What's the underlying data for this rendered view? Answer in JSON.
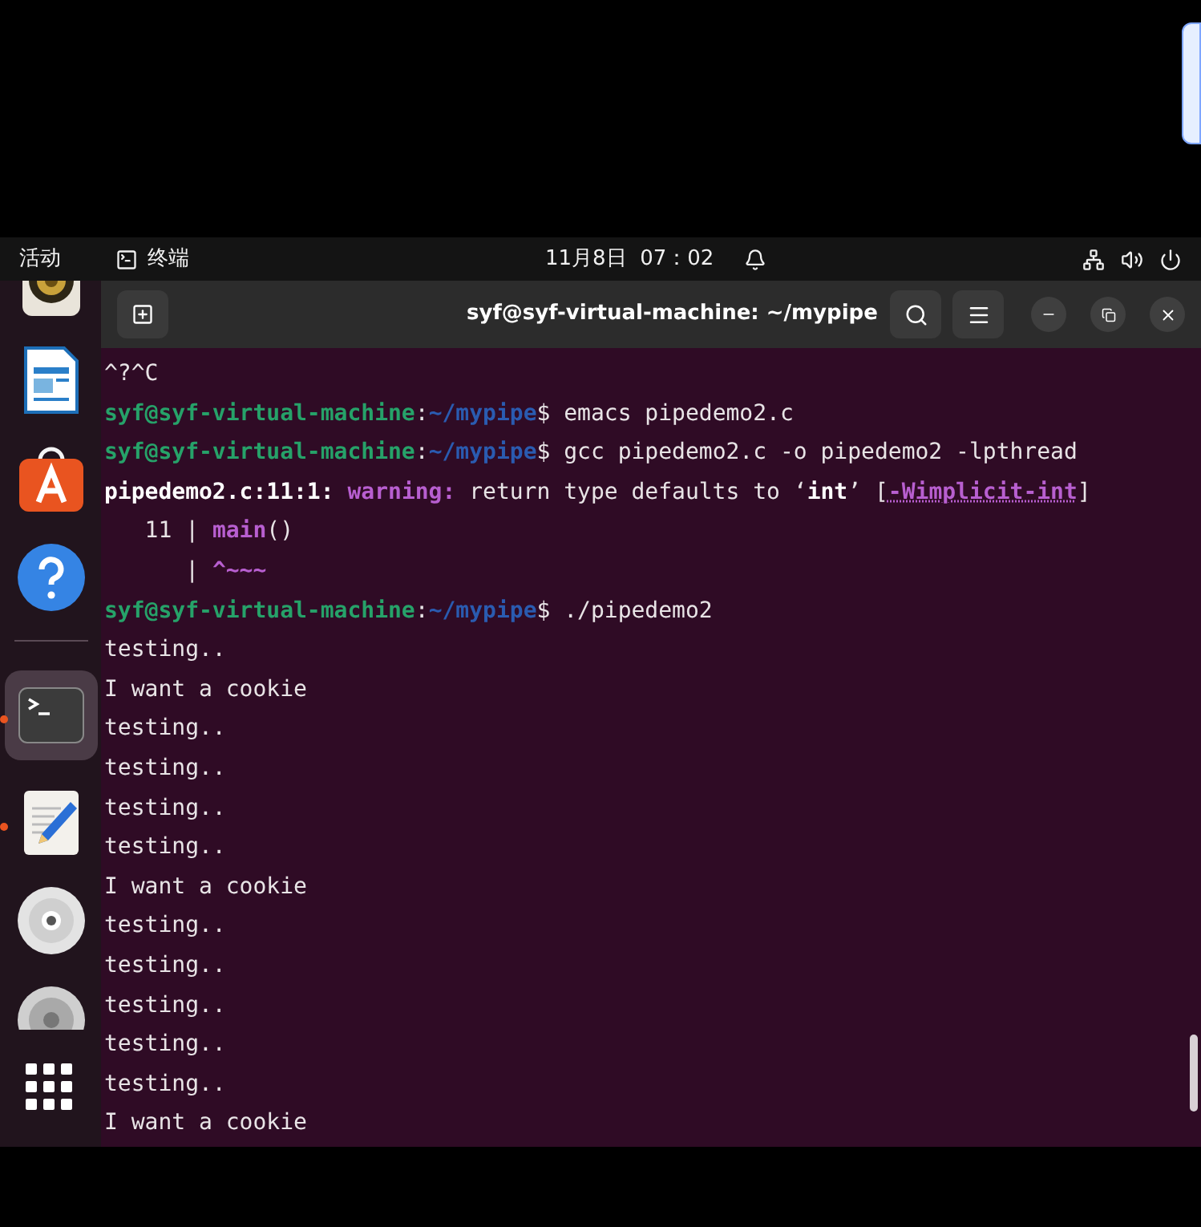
{
  "top_bar": {
    "activities": "活动",
    "app_name": "终端",
    "clock": "11月8日  07：02"
  },
  "dock": {
    "items": [
      {
        "kind": "speaker",
        "running": false,
        "selected": false
      },
      {
        "kind": "document",
        "running": false,
        "selected": false
      },
      {
        "kind": "store",
        "running": false,
        "selected": false
      },
      {
        "kind": "help",
        "running": false,
        "selected": false
      },
      {
        "kind": "separator"
      },
      {
        "kind": "terminal",
        "running": true,
        "selected": true
      },
      {
        "kind": "editor",
        "running": true,
        "selected": false
      },
      {
        "kind": "disc",
        "running": false,
        "selected": false
      },
      {
        "kind": "disc-cut",
        "running": false,
        "selected": false
      }
    ]
  },
  "window": {
    "title": "syf@syf-virtual-machine: ~/mypipe"
  },
  "terminal": {
    "lines": [
      [
        {
          "kind": "plain",
          "text": "^?^C"
        }
      ],
      [
        {
          "kind": "user",
          "text": "syf@syf-virtual-machine"
        },
        {
          "kind": "plain",
          "text": ":"
        },
        {
          "kind": "path",
          "text": "~/mypipe"
        },
        {
          "kind": "plain",
          "text": "$ emacs pipedemo2.c"
        }
      ],
      [
        {
          "kind": "user",
          "text": "syf@syf-virtual-machine"
        },
        {
          "kind": "plain",
          "text": ":"
        },
        {
          "kind": "path",
          "text": "~/mypipe"
        },
        {
          "kind": "plain",
          "text": "$ gcc pipedemo2.c -o pipedemo2 -lpthread"
        }
      ],
      [
        {
          "kind": "bold",
          "text": "pipedemo2.c:11:1:"
        },
        {
          "kind": "warning",
          "text": " warning:"
        },
        {
          "kind": "plain",
          "text": " return type defaults to ‘"
        },
        {
          "kind": "bold",
          "text": "int"
        },
        {
          "kind": "plain",
          "text": "’ ["
        },
        {
          "kind": "flag",
          "text": "-Wimplicit-int"
        },
        {
          "kind": "plain",
          "text": "]"
        }
      ],
      [
        {
          "kind": "plain",
          "text": "   11 | "
        },
        {
          "kind": "code",
          "text": "main"
        },
        {
          "kind": "plain",
          "text": "()"
        }
      ],
      [
        {
          "kind": "plain",
          "text": "      | "
        },
        {
          "kind": "code",
          "text": "^~~~"
        }
      ],
      [
        {
          "kind": "user",
          "text": "syf@syf-virtual-machine"
        },
        {
          "kind": "plain",
          "text": ":"
        },
        {
          "kind": "path",
          "text": "~/mypipe"
        },
        {
          "kind": "plain",
          "text": "$ ./pipedemo2"
        }
      ],
      [
        {
          "kind": "plain",
          "text": "testing.."
        }
      ],
      [
        {
          "kind": "plain",
          "text": "I want a cookie"
        }
      ],
      [
        {
          "kind": "plain",
          "text": "testing.."
        }
      ],
      [
        {
          "kind": "plain",
          "text": "testing.."
        }
      ],
      [
        {
          "kind": "plain",
          "text": "testing.."
        }
      ],
      [
        {
          "kind": "plain",
          "text": "testing.."
        }
      ],
      [
        {
          "kind": "plain",
          "text": "I want a cookie"
        }
      ],
      [
        {
          "kind": "plain",
          "text": "testing.."
        }
      ],
      [
        {
          "kind": "plain",
          "text": "testing.."
        }
      ],
      [
        {
          "kind": "plain",
          "text": "testing.."
        }
      ],
      [
        {
          "kind": "plain",
          "text": "testing.."
        }
      ],
      [
        {
          "kind": "plain",
          "text": "testing.."
        }
      ],
      [
        {
          "kind": "plain",
          "text": "I want a cookie"
        }
      ]
    ]
  }
}
